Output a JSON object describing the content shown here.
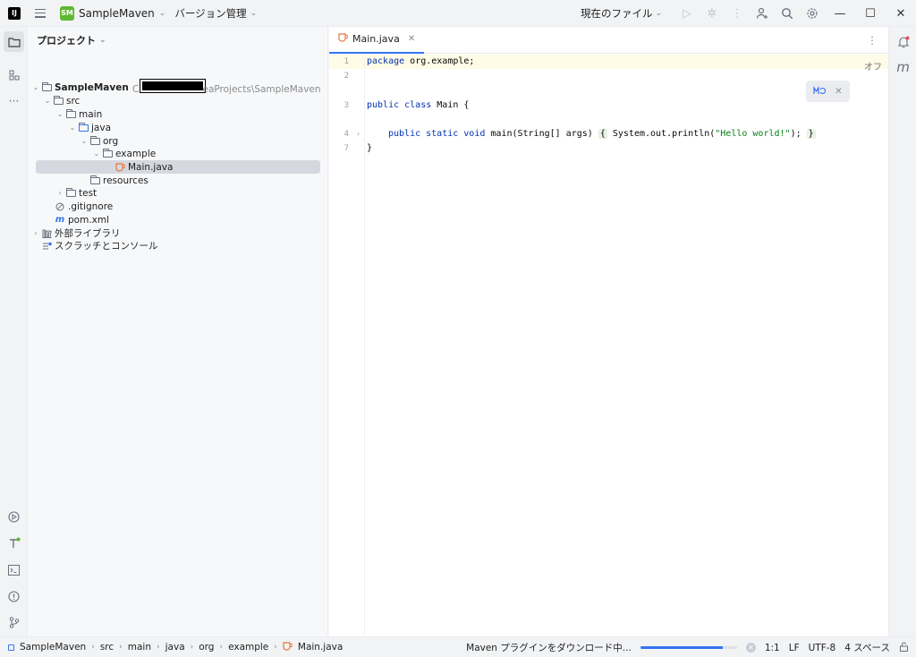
{
  "titlebar": {
    "logo": "IJ",
    "project_badge": "SM",
    "project_name": "SampleMaven",
    "vcs_label": "バージョン管理",
    "run_config": "現在のファイル"
  },
  "project_panel": {
    "title": "プロジェクト",
    "tree": [
      {
        "label": "SampleMaven",
        "path_hint_prefix": "C",
        "path_hint_suffix": "eaProjects\\SampleMaven"
      },
      {
        "label": "src"
      },
      {
        "label": "main"
      },
      {
        "label": "java"
      },
      {
        "label": "org"
      },
      {
        "label": "example"
      },
      {
        "label": "Main.java"
      },
      {
        "label": "resources"
      },
      {
        "label": "test"
      },
      {
        "label": ".gitignore"
      },
      {
        "label": "pom.xml"
      },
      {
        "label": "外部ライブラリ"
      },
      {
        "label": "スクラッチとコンソール"
      }
    ]
  },
  "editor": {
    "tab_label": "Main.java",
    "line_numbers": [
      "1",
      "2",
      "3",
      "4",
      "7"
    ],
    "code": {
      "l1_kw": "package",
      "l1_rest": " org.example;",
      "l3_kw": "public class",
      "l3_rest": " Main {",
      "l4_kw": "public static void",
      "l4_mid": " main(String[] args) ",
      "l4_fold_open": "{",
      "l4_call": " System.out.println(",
      "l4_str": "\"Hello world!\"",
      "l4_end": ");",
      "l4_fold_close": "}",
      "l7": "}"
    },
    "inlay_label": "オフ"
  },
  "statusbar": {
    "crumbs": [
      "SampleMaven",
      "src",
      "main",
      "java",
      "org",
      "example",
      "Main.java"
    ],
    "message": "Maven プラグインをダウンロード中...",
    "progress": 0.85,
    "position": "1:1",
    "line_sep": "LF",
    "encoding": "UTF-8",
    "indent": "4 スペース"
  },
  "colors": {
    "accent": "#3574f0",
    "keyword": "#0033b3",
    "string": "#067d17"
  }
}
